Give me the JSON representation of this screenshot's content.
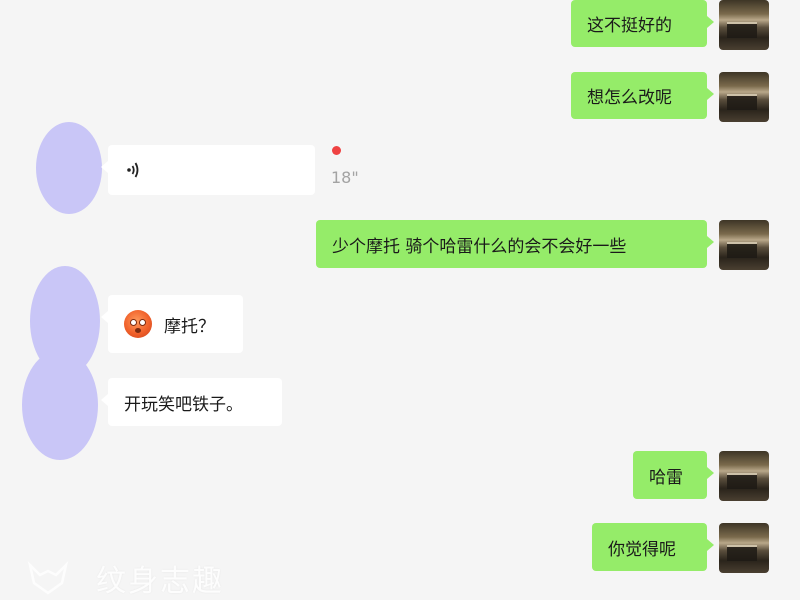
{
  "messages": [
    {
      "side": "me",
      "text": "这不挺好的"
    },
    {
      "side": "me",
      "text": "想怎么改呢"
    },
    {
      "side": "other",
      "type": "voice",
      "duration": "18\""
    },
    {
      "side": "me",
      "text": "少个摩托 骑个哈雷什么的会不会好一些"
    },
    {
      "side": "other",
      "emoji": "blushing-face-emoji",
      "text": "摩托？"
    },
    {
      "side": "other",
      "text": "开玩笑吧铁子。"
    },
    {
      "side": "me",
      "text": "哈雷"
    },
    {
      "side": "me",
      "text": "你觉得呢"
    }
  ],
  "voice_icon": "voice-wave-icon",
  "watermark": {
    "text": "纹身志趣"
  },
  "colors": {
    "background": "#f5f5f5",
    "my_bubble": "#95ec69",
    "other_bubble": "#ffffff",
    "unread_dot": "#ef4242",
    "blur_avatar": "#c9c6f7"
  }
}
